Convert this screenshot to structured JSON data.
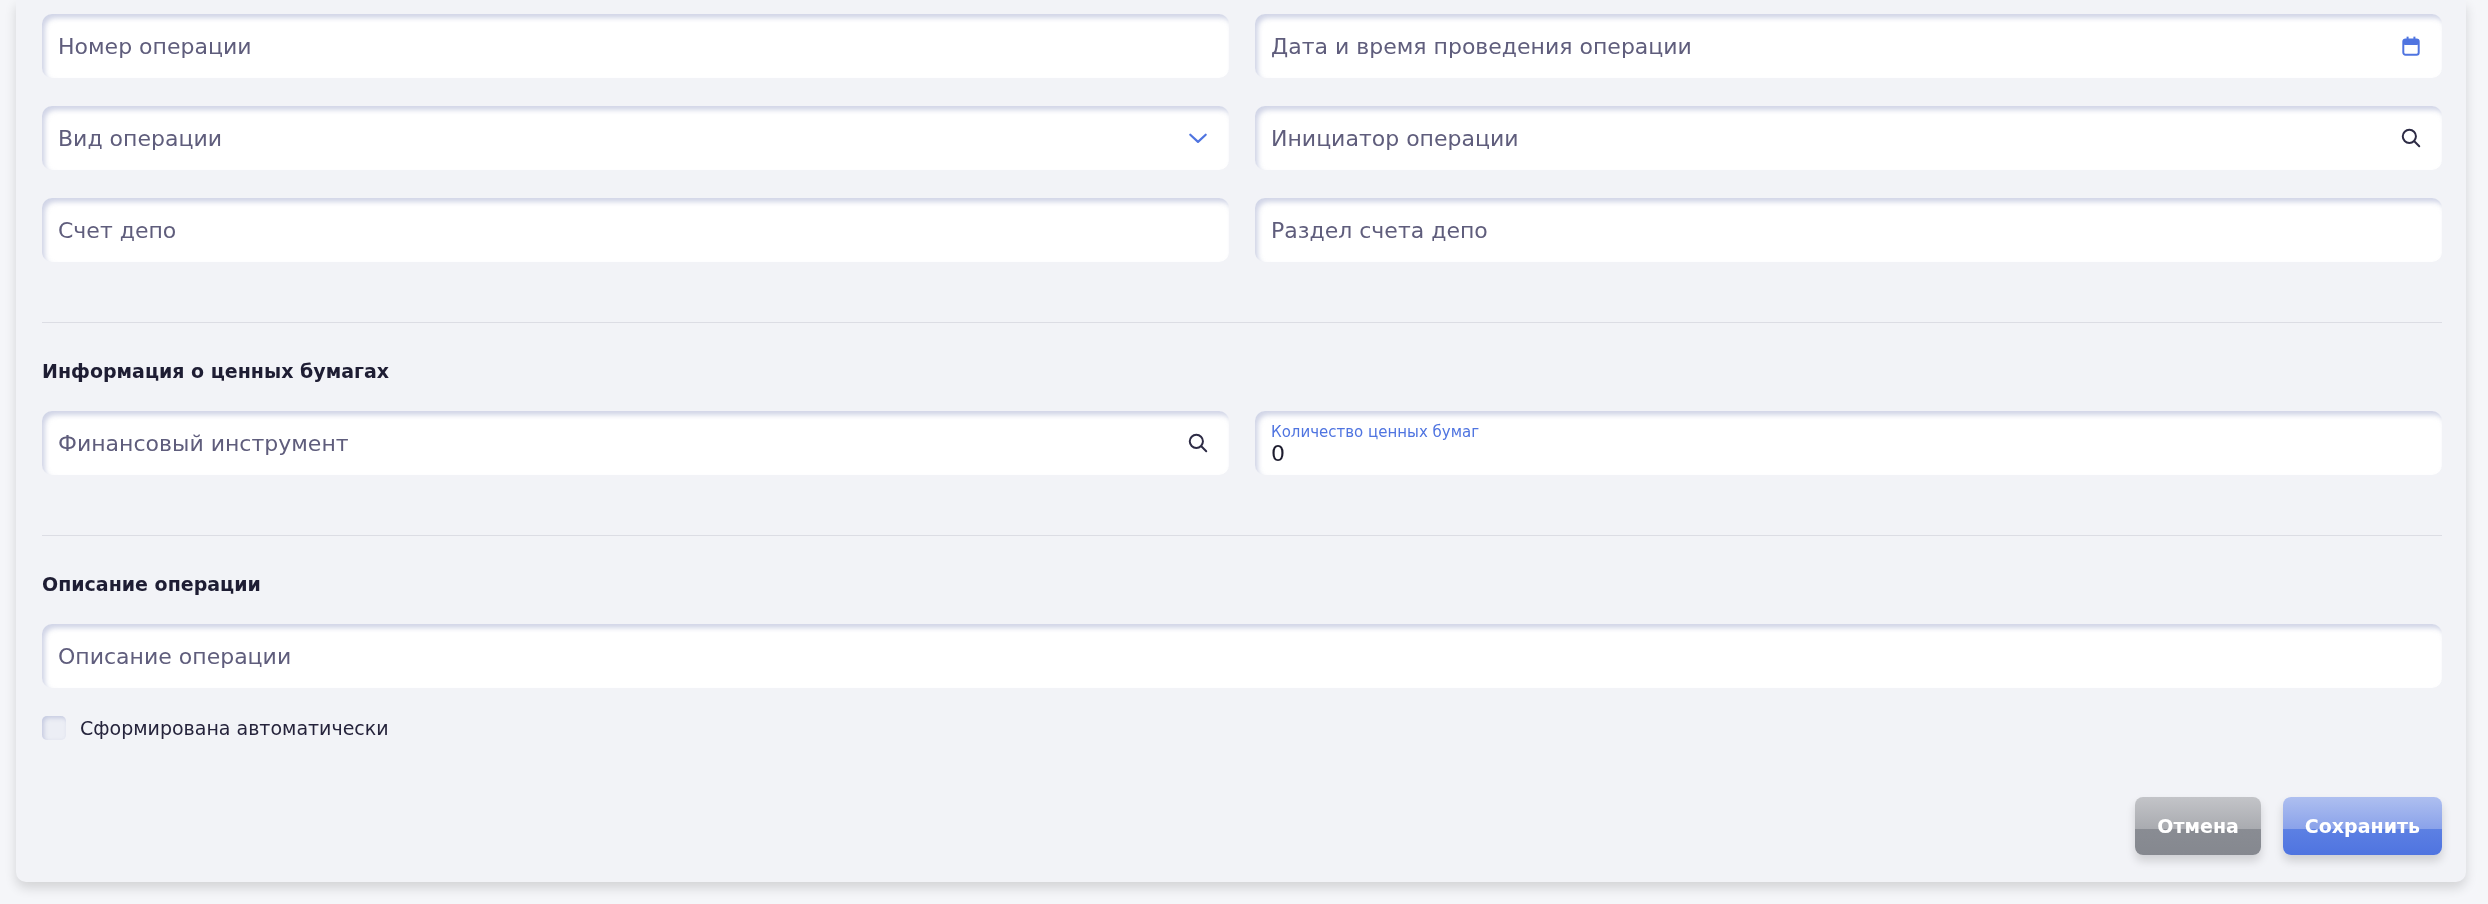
{
  "sections": [
    {
      "fields": [
        {
          "kind": "text",
          "placeholder": "Номер операции"
        },
        {
          "kind": "date",
          "placeholder": "Дата и время проведения операции"
        },
        {
          "kind": "select",
          "placeholder": "Вид операции"
        },
        {
          "kind": "search",
          "placeholder": "Инициатор операции"
        },
        {
          "kind": "text",
          "placeholder": "Счет депо"
        },
        {
          "kind": "text",
          "placeholder": "Раздел счета депо"
        }
      ]
    },
    {
      "heading": "Информация о ценных бумагах",
      "fields": [
        {
          "kind": "search",
          "placeholder": "Финансовый инструмент"
        },
        {
          "kind": "number",
          "label": "Количество ценных бумаг",
          "value": "0"
        }
      ]
    },
    {
      "heading": "Описание операции",
      "fields": [
        {
          "kind": "text",
          "placeholder": "Описание операции",
          "full_width": true
        }
      ]
    }
  ],
  "checkbox": {
    "label": "Сформирована автоматически",
    "checked": false
  },
  "buttons": [
    {
      "label": "Отмена",
      "kind": "secondary"
    },
    {
      "label": "Сохранить",
      "kind": "primary"
    }
  ]
}
